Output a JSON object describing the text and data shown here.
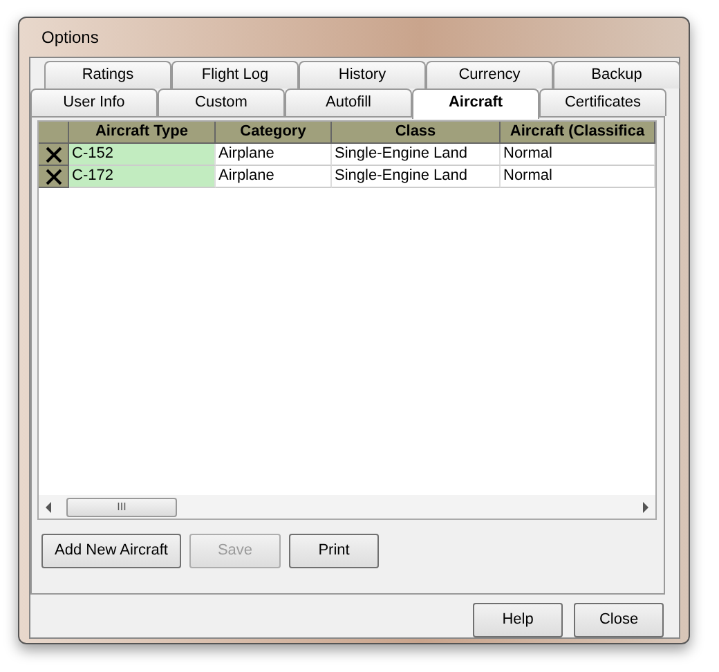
{
  "window": {
    "title": "Options"
  },
  "tab_rows": [
    {
      "tabs": [
        {
          "label": "Ratings",
          "selected": false
        },
        {
          "label": "Flight Log",
          "selected": false
        },
        {
          "label": "History",
          "selected": false
        },
        {
          "label": "Currency",
          "selected": false
        },
        {
          "label": "Backup",
          "selected": false
        }
      ]
    },
    {
      "tabs": [
        {
          "label": "User Info",
          "selected": false
        },
        {
          "label": "Custom",
          "selected": false
        },
        {
          "label": "Autofill",
          "selected": false
        },
        {
          "label": "Aircraft",
          "selected": true
        },
        {
          "label": "Certificates",
          "selected": false
        }
      ]
    }
  ],
  "table": {
    "columns": [
      "Aircraft Type",
      "Category",
      "Class",
      "Aircraft (Classifica"
    ],
    "rows": [
      {
        "cells": [
          "C-152",
          "Airplane",
          "Single-Engine Land",
          "Normal"
        ]
      },
      {
        "cells": [
          "C-172",
          "Airplane",
          "Single-Engine Land",
          "Normal"
        ]
      }
    ]
  },
  "scrollbar_grip": "III",
  "panel_buttons": [
    {
      "label": "Add New Aircraft",
      "disabled": false
    },
    {
      "label": "Save",
      "disabled": true
    },
    {
      "label": "Print",
      "disabled": false
    }
  ],
  "dialog_buttons": [
    {
      "label": "Help",
      "disabled": false
    },
    {
      "label": "Close",
      "disabled": false
    }
  ]
}
